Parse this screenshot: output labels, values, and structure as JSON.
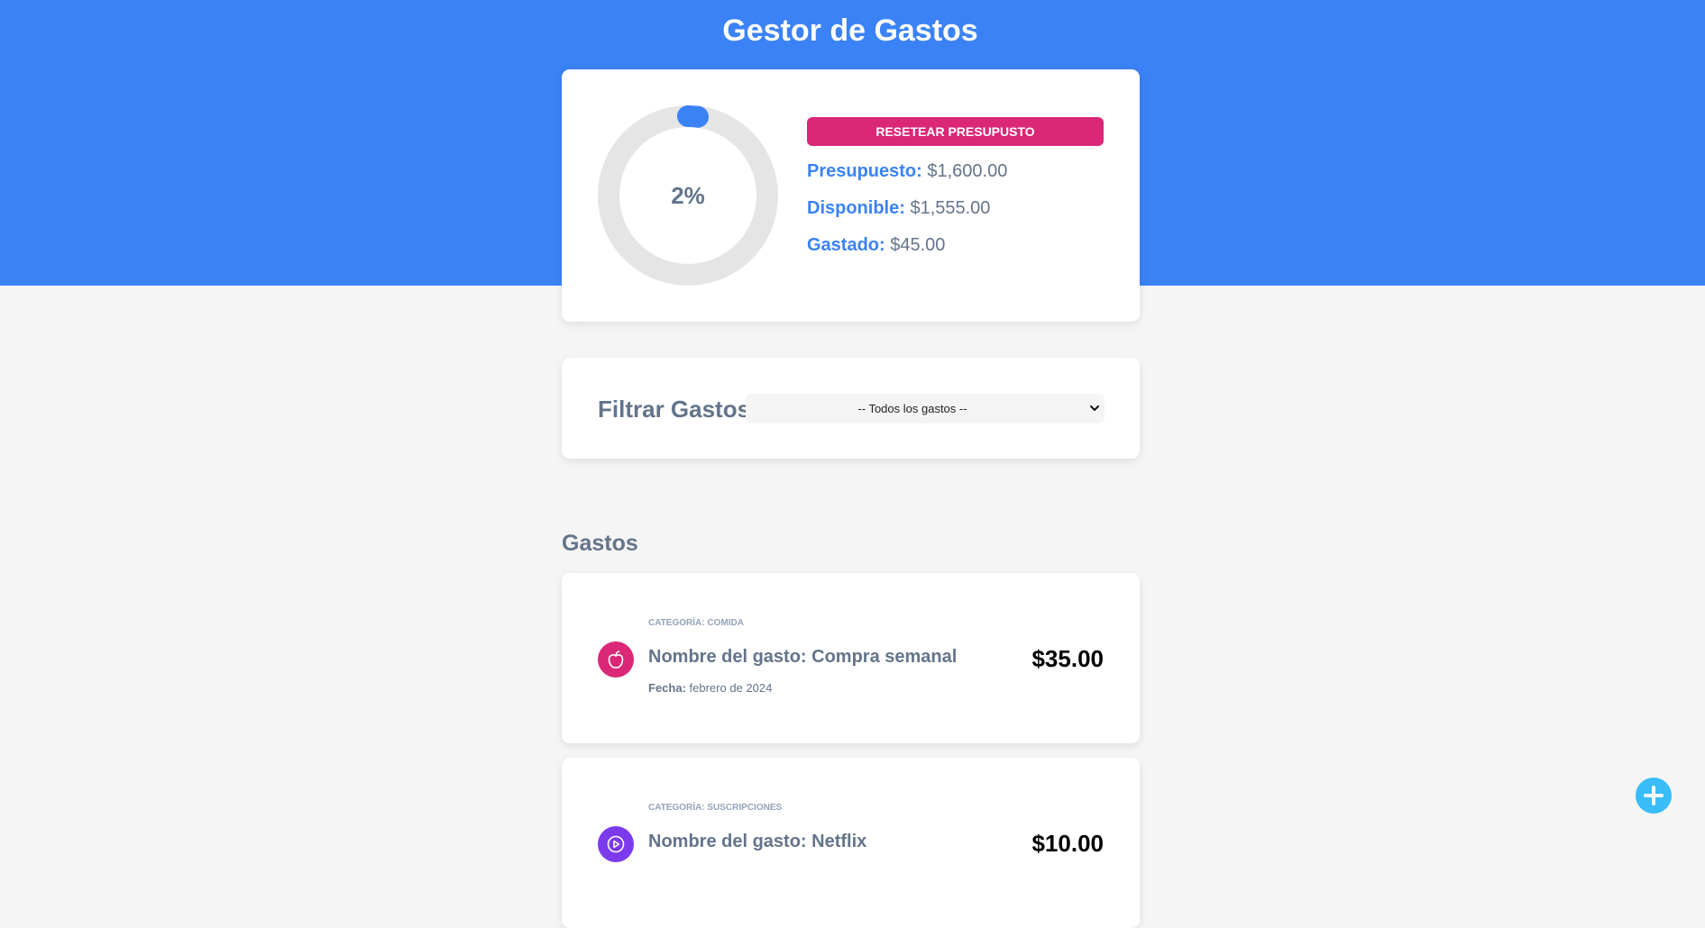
{
  "header": {
    "title": "Gestor de Gastos"
  },
  "budget": {
    "percent_spent": 2,
    "percent_label": "2%",
    "reset_button_label": "RESETEAR PRESUPUSTO",
    "budget_label": "Presupuesto:",
    "budget_value": "$1,600.00",
    "available_label": "Disponible:",
    "available_value": "$1,555.00",
    "spent_label": "Gastado:",
    "spent_value": "$45.00"
  },
  "filter": {
    "label": "Filtrar Gastos",
    "selected_option": "-- Todos los gastos --"
  },
  "expenses_section": {
    "title": "Gastos",
    "items": [
      {
        "category": "Categoría: Comida",
        "name": "Nombre del gasto: Compra semanal",
        "date_label": "Fecha:",
        "date_value": "febrero de 2024",
        "amount": "$35.00",
        "icon": "apple-icon",
        "icon_color": "#db2777"
      },
      {
        "category": "Categoría: Suscripciones",
        "name": "Nombre del gasto: Netflix",
        "amount": "$10.00",
        "icon": "play-icon",
        "icon_color": "#7c3aed"
      }
    ]
  },
  "add_button": {
    "icon": "plus-icon"
  },
  "colors": {
    "primary": "#3b82f6",
    "reset": "#db2777",
    "background": "#f5f5f5",
    "ring_track": "#e5e5e5",
    "add_button": "#38bdf8"
  }
}
